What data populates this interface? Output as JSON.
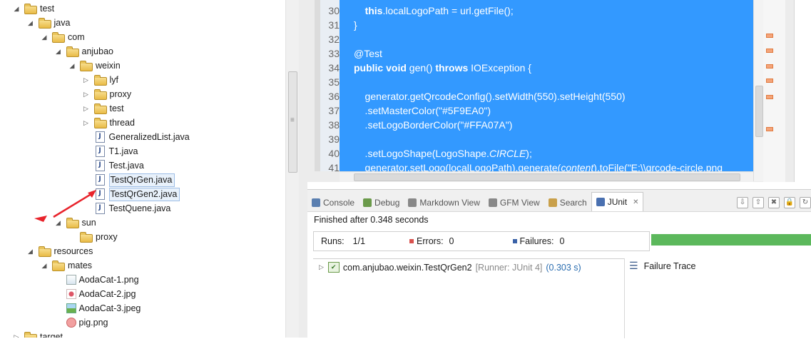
{
  "tree": [
    {
      "label": "test",
      "type": "folder",
      "depth": 0,
      "state": "open"
    },
    {
      "label": "java",
      "type": "folder",
      "depth": 1,
      "state": "open"
    },
    {
      "label": "com",
      "type": "folder",
      "depth": 2,
      "state": "open"
    },
    {
      "label": "anjubao",
      "type": "folder",
      "depth": 3,
      "state": "open"
    },
    {
      "label": "weixin",
      "type": "folder",
      "depth": 4,
      "state": "open"
    },
    {
      "label": "lyf",
      "type": "folder",
      "depth": 5,
      "state": "closed"
    },
    {
      "label": "proxy",
      "type": "folder",
      "depth": 5,
      "state": "closed"
    },
    {
      "label": "test",
      "type": "folder",
      "depth": 5,
      "state": "closed"
    },
    {
      "label": "thread",
      "type": "folder",
      "depth": 5,
      "state": "closed"
    },
    {
      "label": "GeneralizedList.java",
      "type": "java",
      "depth": 5,
      "state": "none"
    },
    {
      "label": "T1.java",
      "type": "java",
      "depth": 5,
      "state": "none"
    },
    {
      "label": "Test.java",
      "type": "java",
      "depth": 5,
      "state": "none"
    },
    {
      "label": "TestQrGen.java",
      "type": "java",
      "depth": 5,
      "state": "none",
      "selected": true
    },
    {
      "label": "TestQrGen2.java",
      "type": "java",
      "depth": 5,
      "state": "none",
      "selected": true
    },
    {
      "label": "TestQuene.java",
      "type": "java",
      "depth": 5,
      "state": "none"
    },
    {
      "label": "sun",
      "type": "folder",
      "depth": 3,
      "state": "open"
    },
    {
      "label": "proxy",
      "type": "folder",
      "depth": 4,
      "state": "none"
    },
    {
      "label": "resources",
      "type": "folder",
      "depth": 1,
      "state": "open"
    },
    {
      "label": "mates",
      "type": "folder",
      "depth": 2,
      "state": "open"
    },
    {
      "label": "AodaCat-1.png",
      "type": "img1",
      "depth": 3,
      "state": "none"
    },
    {
      "label": "AodaCat-2.jpg",
      "type": "img2",
      "depth": 3,
      "state": "none"
    },
    {
      "label": "AodaCat-3.jpeg",
      "type": "img3",
      "depth": 3,
      "state": "none"
    },
    {
      "label": "pig.png",
      "type": "img4",
      "depth": 3,
      "state": "none"
    },
    {
      "label": "target",
      "type": "folder",
      "depth": 0,
      "state": "closed"
    }
  ],
  "editor": {
    "line_numbers": [
      "30",
      "31",
      "32",
      "33",
      "34",
      "35",
      "36",
      "37",
      "38",
      "39",
      "40",
      "41"
    ],
    "lines": [
      {
        "parts": [
          {
            "t": "    "
          },
          {
            "t": "this",
            "kw": true
          },
          {
            "t": ".localLogoPath = url.getFile();"
          }
        ]
      },
      {
        "parts": [
          {
            "t": "}"
          }
        ]
      },
      {
        "parts": [
          {
            "t": ""
          }
        ]
      },
      {
        "parts": [
          {
            "t": "@Test"
          }
        ]
      },
      {
        "parts": [
          {
            "t": "public void",
            "kw": true
          },
          {
            "t": " gen() "
          },
          {
            "t": "throws",
            "kw": true
          },
          {
            "t": " IOException {"
          }
        ]
      },
      {
        "parts": [
          {
            "t": ""
          }
        ]
      },
      {
        "parts": [
          {
            "t": "    generator.getQrcodeConfig().setWidth(550).setHeight(550)"
          }
        ]
      },
      {
        "parts": [
          {
            "t": "    .setMasterColor(\"#5F9EA0\")"
          }
        ]
      },
      {
        "parts": [
          {
            "t": "    .setLogoBorderColor(\"#FFA07A\")"
          }
        ]
      },
      {
        "parts": [
          {
            "t": ""
          }
        ]
      },
      {
        "parts": [
          {
            "t": "    .setLogoShape(LogoShape."
          },
          {
            "t": "CIRCLE",
            "it": true
          },
          {
            "t": ");"
          }
        ]
      },
      {
        "parts": [
          {
            "t": "    generator.setLogo(localLogoPath).generate("
          },
          {
            "t": "content",
            "it": true
          },
          {
            "t": ").toFile(\"E:\\\\qrcode-circle.png"
          }
        ]
      }
    ]
  },
  "bottom": {
    "tabs": [
      {
        "label": "Console",
        "icon": "console-icon",
        "color": "#5a7fb0"
      },
      {
        "label": "Debug",
        "icon": "debug-icon",
        "color": "#6a9a4a"
      },
      {
        "label": "Markdown View",
        "icon": "markdown-icon",
        "color": "#888888"
      },
      {
        "label": "GFM View",
        "icon": "gfm-icon",
        "color": "#888888"
      },
      {
        "label": "Search",
        "icon": "search-icon",
        "color": "#c9a04a"
      },
      {
        "label": "JUnit",
        "icon": "junit-icon",
        "color": "#4a70b0",
        "active": true
      }
    ],
    "finished": "Finished after 0.348 seconds",
    "runs_label": "Runs:",
    "runs_value": "1/1",
    "errors_label": "Errors:",
    "errors_value": "0",
    "failures_label": "Failures:",
    "failures_value": "0",
    "test_name": "com.anjubao.weixin.TestQrGen2",
    "test_runner": "[Runner: JUnit 4]",
    "test_time": "(0.303 s)",
    "failure_trace": "Failure Trace",
    "success_color": "#5cb85c",
    "error_color": "#d9534f",
    "failure_color": "#3a62a8"
  }
}
